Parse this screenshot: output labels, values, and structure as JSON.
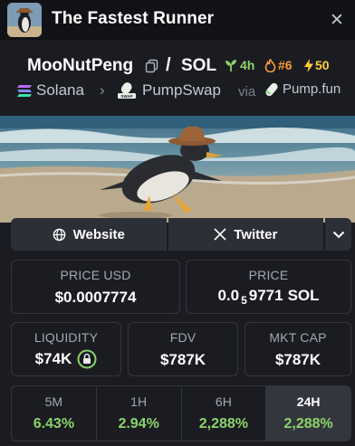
{
  "header": {
    "title": "The Fastest Runner",
    "close_icon": "close-icon"
  },
  "token": {
    "name": "MooNutPeng",
    "separator": "/",
    "quote": "SOL",
    "age": "4h",
    "rank": "#6",
    "boosts": "50"
  },
  "chain": {
    "network": "Solana",
    "dex": "PumpSwap",
    "via_label": "via",
    "launchpad": "Pump.fun",
    "colors": {
      "age": "#8bd36a",
      "rank": "#ff9b37",
      "boost": "#ffcc3a"
    }
  },
  "links": {
    "website": "Website",
    "twitter": "Twitter"
  },
  "prices": {
    "price_usd_label": "PRICE USD",
    "price_usd": "$0.0007774",
    "price_label": "PRICE",
    "price_native_prefix": "0.0",
    "price_native_zeros": "5",
    "price_native_digits": "9771",
    "price_native_unit": "SOL"
  },
  "stats": {
    "liquidity_label": "LIQUIDITY",
    "liquidity": "$74K",
    "fdv_label": "FDV",
    "fdv": "$787K",
    "mcap_label": "MKT CAP",
    "mcap": "$787K"
  },
  "timeframes": [
    {
      "label": "5M",
      "value": "6.43%"
    },
    {
      "label": "1H",
      "value": "2.94%"
    },
    {
      "label": "6H",
      "value": "2,288%"
    },
    {
      "label": "24H",
      "value": "2,288%"
    }
  ]
}
